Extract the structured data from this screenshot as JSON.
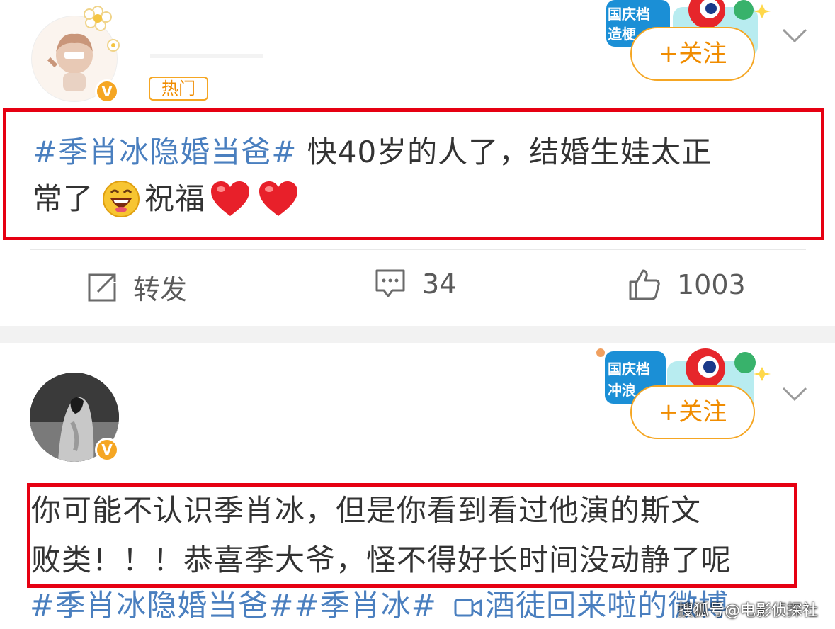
{
  "posts": [
    {
      "badge": "热门",
      "banner_text": "国庆档 造梗",
      "follow_label": "+关注",
      "content": {
        "topic": "#季肖冰隐婚当爸#",
        "text_line1": " 快40岁的人了，结婚生娃太正",
        "text_line2_a": "常了",
        "text_line2_b": " 祝福"
      },
      "actions": {
        "repost_label": "转发",
        "comment_count": "34",
        "like_count": "1003"
      }
    },
    {
      "banner_text": "国庆档 冲浪",
      "follow_label": "+关注",
      "content": {
        "line1": "你可能不认识季肖冰，但是你看到看过他演的斯文",
        "line2": "败类！！！恭喜季大爷，怪不得好长时间没动静了呢"
      },
      "tags_line": {
        "topic1": "#季肖冰隐婚当爸#",
        "topic2": "#季肖冰#",
        "video_text": "酒徒回来啦的微博"
      }
    }
  ],
  "watermark": "搜狐号@电影侦探社",
  "colors": {
    "accent": "#f5a623",
    "topic": "#4a7fbf",
    "highlight_box": "#e60012",
    "separator": "#f2f2f2"
  },
  "icons": [
    "verified-v-icon",
    "chevron-down-icon",
    "repost-icon",
    "comment-icon",
    "like-icon",
    "laugh-emoji-icon",
    "heart-icon",
    "video-icon"
  ]
}
